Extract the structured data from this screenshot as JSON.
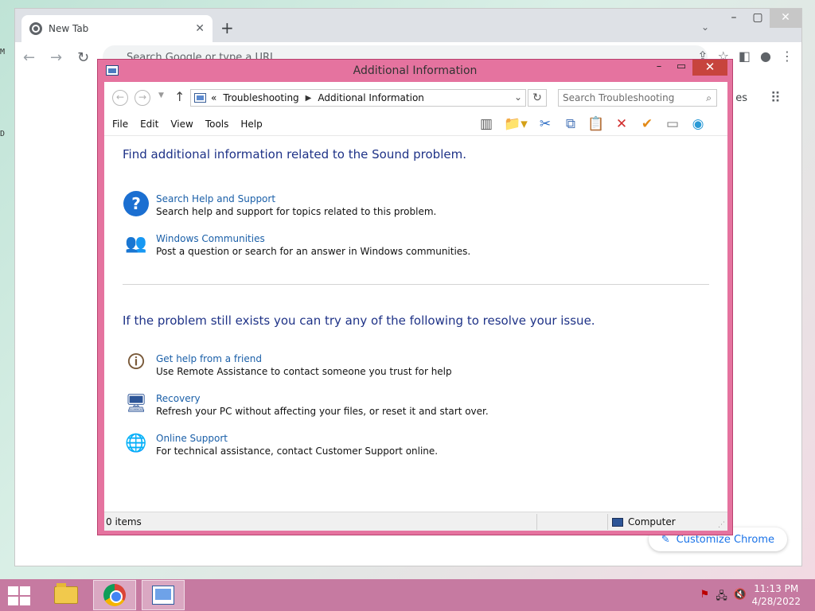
{
  "desktop": {
    "glyph_top": "M",
    "glyph_mid": "D"
  },
  "chrome": {
    "tab_title": "New Tab",
    "tab_close": "✕",
    "new_tab": "+",
    "omnibox_placeholder": "Search Google or type a URL",
    "fragment_text": "es",
    "customize_label": "Customize Chrome"
  },
  "window": {
    "title": "Additional Information",
    "address": {
      "overflow": "«",
      "crumbs": [
        "Troubleshooting",
        "Additional Information"
      ]
    },
    "search_placeholder": "Search Troubleshooting",
    "menu": [
      "File",
      "Edit",
      "View",
      "Tools",
      "Help"
    ],
    "content": {
      "heading1": "Find additional information related to the Sound problem.",
      "tasks1": [
        {
          "icon": "help-icon",
          "link": "Search Help and Support",
          "desc": "Search help and support for topics related to this problem."
        },
        {
          "icon": "communities-icon",
          "link": "Windows Communities",
          "desc": "Post a question or search for an answer in Windows communities."
        }
      ],
      "heading2": "If the problem still exists you can try any of the following to resolve your issue.",
      "tasks2": [
        {
          "icon": "remote-assistance-icon",
          "link": "Get help from a friend",
          "desc": "Use Remote Assistance to contact someone you trust for help"
        },
        {
          "icon": "recovery-icon",
          "link": "Recovery",
          "desc": "Refresh your PC without affecting your files, or reset it and start over."
        },
        {
          "icon": "globe-icon",
          "link": "Online Support",
          "desc": "For technical assistance, contact Customer Support online."
        }
      ]
    },
    "status": {
      "items": "0 items",
      "location": "Computer"
    }
  },
  "taskbar": {
    "time": "11:13 PM",
    "date": "4/28/2022"
  },
  "colors": {
    "window_frame": "#e5739f",
    "close_red": "#c7443d",
    "heading_blue": "#1e3287",
    "link_blue": "#1a5fa8",
    "taskbar": "#c67aa1"
  }
}
